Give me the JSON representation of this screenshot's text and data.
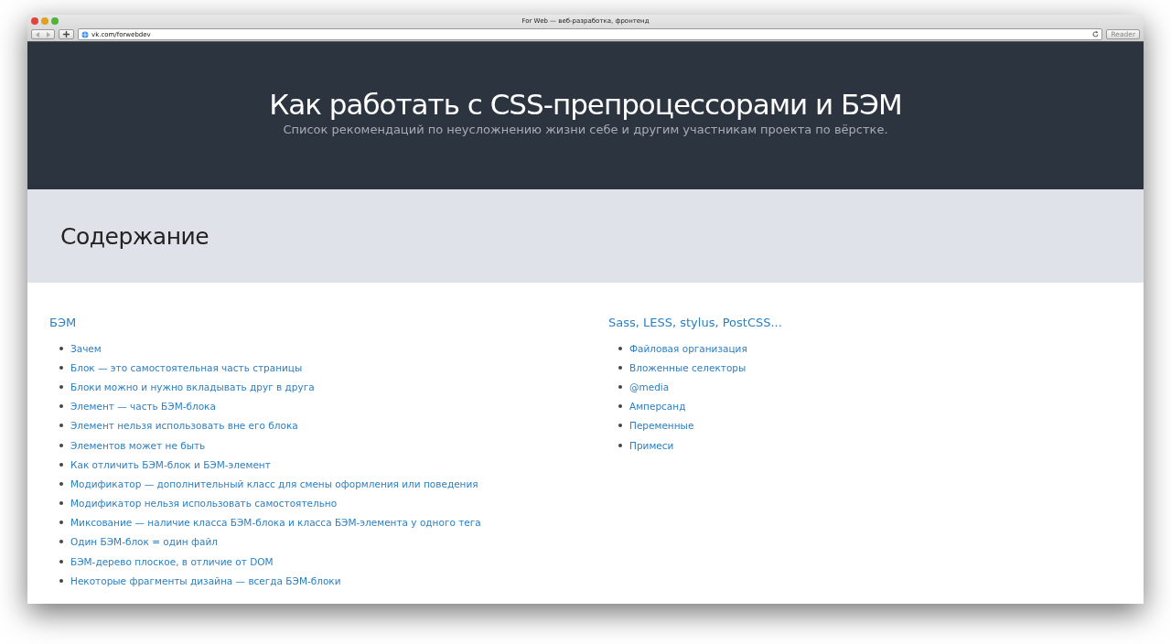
{
  "window": {
    "title": "For Web — веб-разработка, фронтенд",
    "address": "vk.com/forwebdev",
    "reader_button": "Reader"
  },
  "header": {
    "title": "Как работать с CSS-препроцессорами и БЭМ",
    "subtitle": "Список рекомендаций по неусложнению жизни себе и другим участникам проекта по вёрстке."
  },
  "contents_title": "Содержание",
  "sections": [
    {
      "title": "БЭМ",
      "items": [
        "Зачем",
        "Блок — это самостоятельная часть страницы",
        "Блоки можно и нужно вкладывать друг в друга",
        "Элемент — часть БЭМ-блока",
        "Элемент нельзя использовать вне его блока",
        "Элементов может не быть",
        "Как отличить БЭМ-блок и БЭМ-элемент",
        "Модификатор — дополнительный класс для смены оформления или поведения",
        "Модификатор нельзя использовать самостоятельно",
        "Миксование — наличие класса БЭМ-блока и класса БЭМ-элемента у одного тега",
        "Один БЭМ-блок = один файл",
        "БЭМ-дерево плоское, в отличие от DOM",
        "Некоторые фрагменты дизайна — всегда БЭМ-блоки"
      ]
    },
    {
      "title": "Sass, LESS, stylus, PostCSS...",
      "items": [
        "Файловая организация",
        "Вложенные селекторы",
        "@media",
        "Амперсанд",
        "Переменные",
        "Примеси"
      ]
    }
  ]
}
